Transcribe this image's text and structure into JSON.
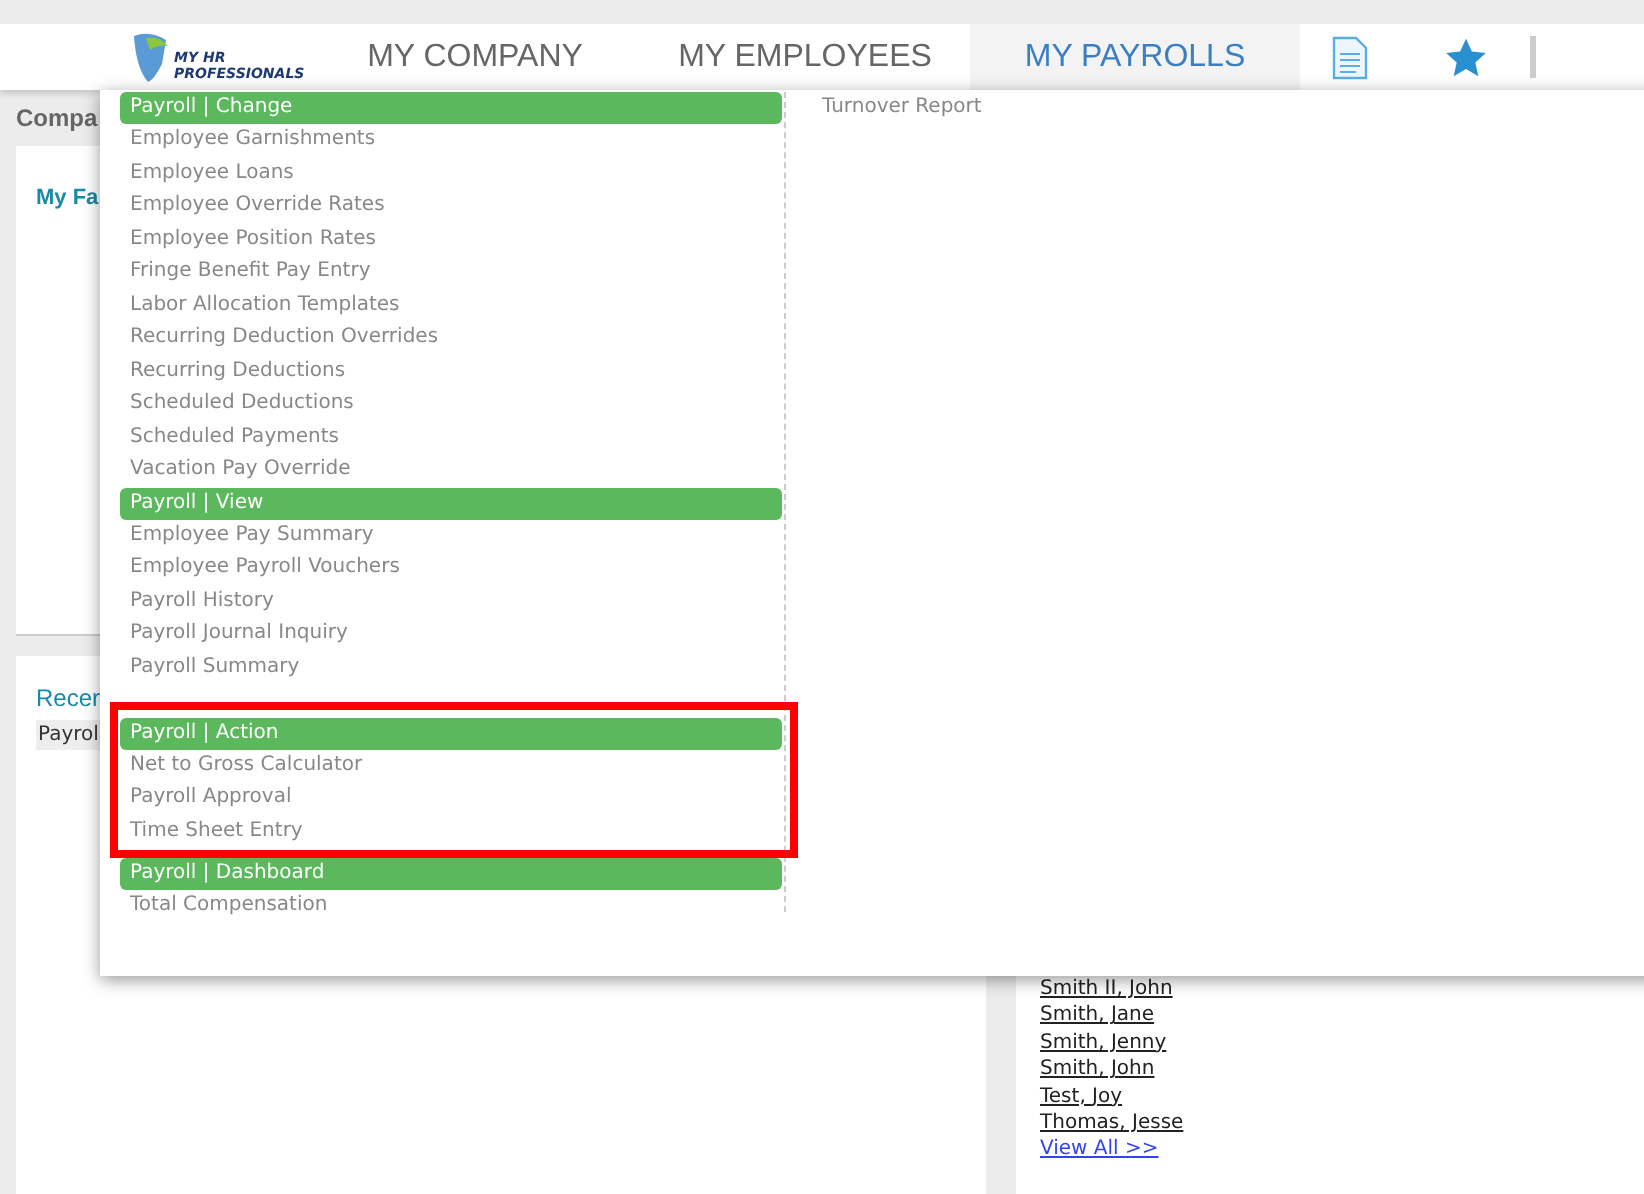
{
  "nav": {
    "logo": {
      "line1": "MY HR",
      "line2": "PROFESSIONALS"
    },
    "items": [
      {
        "label": "MY COMPANY",
        "selected": false
      },
      {
        "label": "MY EMPLOYEES",
        "selected": false
      },
      {
        "label": "MY PAYROLLS",
        "selected": true
      }
    ]
  },
  "page": {
    "section_title": "Compa",
    "favorites_title": "My Fa",
    "recent_title": "Recer",
    "recent_tag": "Payrol"
  },
  "menu": {
    "groups": [
      {
        "title": "Payroll | Change",
        "items": [
          "Employee Garnishments",
          "Employee Loans",
          "Employee Override Rates",
          "Employee Position Rates",
          "Fringe Benefit Pay Entry",
          "Labor Allocation Templates",
          "Recurring Deduction Overrides",
          "Recurring Deductions",
          "Scheduled Deductions",
          "Scheduled Payments",
          "Vacation Pay Override"
        ]
      },
      {
        "title": "Payroll | View",
        "items": [
          "Employee Pay Summary",
          "Employee Payroll Vouchers",
          "Payroll History",
          "Payroll Journal Inquiry",
          "Payroll Summary"
        ]
      },
      {
        "title": "Payroll | Action",
        "items": [
          "Net to Gross Calculator",
          "Payroll Approval",
          "Time Sheet Entry"
        ]
      },
      {
        "title": "Payroll | Dashboard",
        "items": [
          "Total Compensation"
        ]
      }
    ],
    "side_items": [
      "Turnover Report"
    ]
  },
  "employees": {
    "names": [
      "Smith II, John",
      "Smith, Jane",
      "Smith, Jenny",
      "Smith, John",
      "Test, Joy",
      "Thomas, Jesse"
    ],
    "view_all": "View All >>"
  }
}
